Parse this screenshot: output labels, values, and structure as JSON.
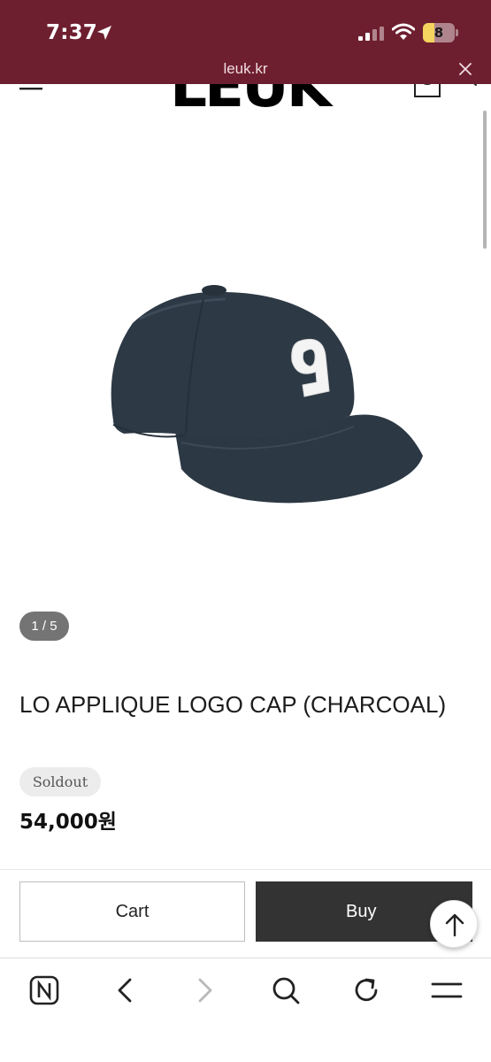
{
  "status_bar": {
    "time": "7:37",
    "battery": "8",
    "icons": [
      "location-arrow-icon",
      "signal-icon",
      "wifi-icon",
      "battery-icon"
    ]
  },
  "browser": {
    "url": "leuk.kr",
    "toolbar_icons": [
      "naver-home-icon",
      "back-icon",
      "forward-icon",
      "search-icon",
      "reload-icon",
      "menu-icon"
    ]
  },
  "site": {
    "logo_text": "LEUK",
    "header_icons": [
      "hamburger-menu-icon",
      "shopping-bag-icon",
      "search-icon"
    ]
  },
  "product": {
    "image_counter": "1 / 5",
    "title": "LO APPLIQUE LOGO CAP (CHARCOAL)",
    "badge": "Soldout",
    "price": "54,000원",
    "image_description_icon": "cap-image",
    "applique_number": "9"
  },
  "actions": {
    "cart_label": "Cart",
    "buy_label": "Buy"
  },
  "colors": {
    "top_bar": "#6e1f2f",
    "buy_button": "#333333",
    "counter_badge": "#747474",
    "battery_fill": "#f4d35e"
  }
}
